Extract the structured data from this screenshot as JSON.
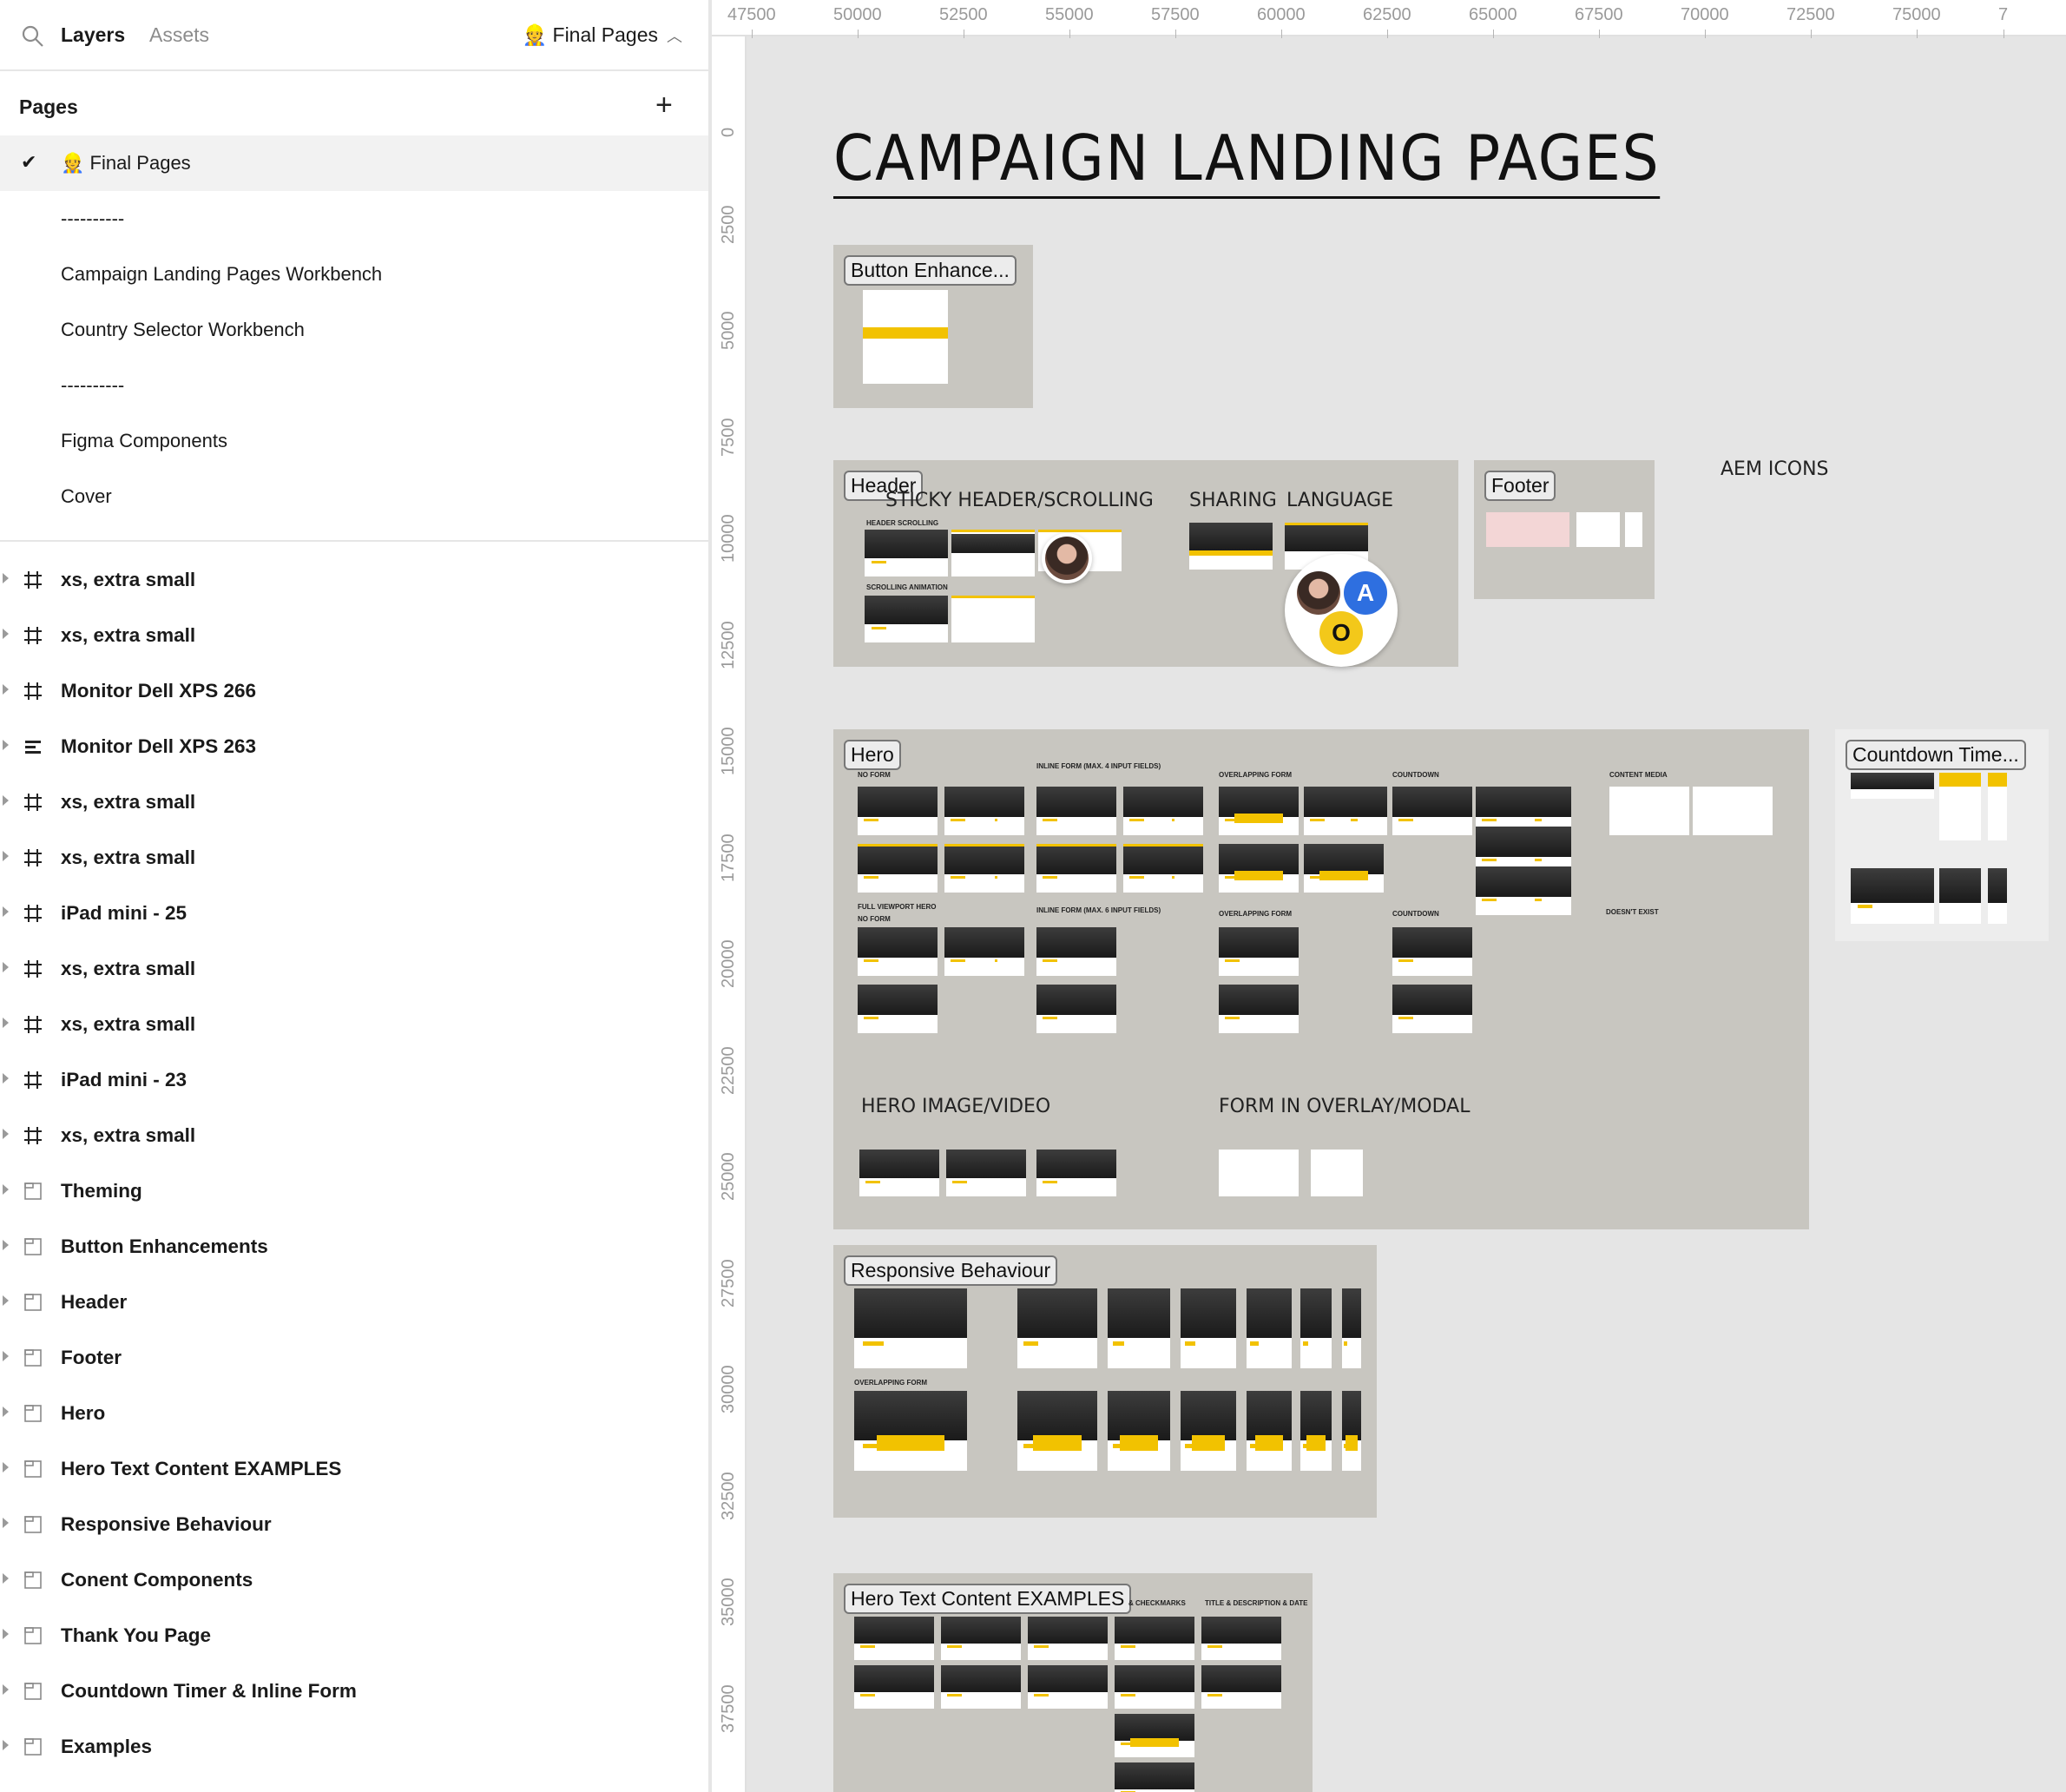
{
  "sidebar": {
    "tabs": {
      "layers": "Layers",
      "assets": "Assets"
    },
    "current_page": "👷 Final Pages",
    "pages_title": "Pages",
    "pages": [
      {
        "label": "👷 Final Pages",
        "active": true
      },
      {
        "label": "----------",
        "active": false
      },
      {
        "label": "Campaign Landing Pages Workbench",
        "active": false
      },
      {
        "label": "Country Selector Workbench",
        "active": false
      },
      {
        "label": "----------",
        "active": false
      },
      {
        "label": "Figma Components",
        "active": false
      },
      {
        "label": "Cover",
        "active": false
      }
    ],
    "layers": [
      {
        "name": "xs, extra small",
        "icon": "frame-icon"
      },
      {
        "name": "xs, extra small",
        "icon": "frame-icon"
      },
      {
        "name": "Monitor Dell XPS 266",
        "icon": "frame-icon"
      },
      {
        "name": "Monitor Dell XPS 263",
        "icon": "auto-layout-icon"
      },
      {
        "name": "xs, extra small",
        "icon": "frame-icon"
      },
      {
        "name": "xs, extra small",
        "icon": "frame-icon"
      },
      {
        "name": "iPad mini - 25",
        "icon": "frame-icon"
      },
      {
        "name": "xs, extra small",
        "icon": "frame-icon"
      },
      {
        "name": "xs, extra small",
        "icon": "frame-icon"
      },
      {
        "name": "iPad mini - 23",
        "icon": "frame-icon"
      },
      {
        "name": "xs, extra small",
        "icon": "frame-icon"
      },
      {
        "name": "Theming",
        "icon": "section-icon"
      },
      {
        "name": "Button Enhancements",
        "icon": "section-icon"
      },
      {
        "name": "Header",
        "icon": "section-icon"
      },
      {
        "name": "Footer",
        "icon": "section-icon"
      },
      {
        "name": "Hero",
        "icon": "section-icon"
      },
      {
        "name": "Hero Text Content EXAMPLES",
        "icon": "section-icon"
      },
      {
        "name": "Responsive Behaviour",
        "icon": "section-icon"
      },
      {
        "name": "Conent Components",
        "icon": "section-icon"
      },
      {
        "name": "Thank You Page",
        "icon": "section-icon"
      },
      {
        "name": "Countdown Timer & Inline Form",
        "icon": "section-icon"
      },
      {
        "name": "Examples",
        "icon": "section-icon"
      }
    ]
  },
  "canvas": {
    "ruler_h": [
      "47500",
      "50000",
      "52500",
      "55000",
      "57500",
      "60000",
      "62500",
      "65000",
      "67500",
      "70000",
      "72500",
      "75000",
      "7"
    ],
    "ruler_v": [
      "0",
      "2500",
      "5000",
      "7500",
      "10000",
      "12500",
      "15000",
      "17500",
      "20000",
      "22500",
      "25000",
      "27500",
      "30000",
      "32500",
      "35000",
      "37500"
    ],
    "title": "CAMPAIGN LANDING PAGES",
    "sections": {
      "button_enh": "Button Enhance...",
      "header": "Header",
      "footer": "Footer",
      "hero": "Hero",
      "countdown": "Countdown Time...",
      "responsive": "Responsive Behaviour",
      "hero_text": "Hero Text Content EXAMPLES"
    },
    "headings": {
      "sticky": "STICKY HEADER/SCROLLING",
      "sharing": "SHARING",
      "language": "LANGUAGE",
      "aem": "AEM ICONS",
      "hero_image": "HERO IMAGE/VIDEO",
      "form_overlay": "FORM IN OVERLAY/MODAL",
      "no_form": "NO FORM",
      "inline_form4": "INLINE FORM (MAX. 4 INPUT FIELDS)",
      "overlapping": "OVERLAPPING FORM",
      "countdown_lbl": "COUNTDOWN",
      "content_media": "CONTENT MEDIA",
      "full_viewport": "FULL VIEWPORT HERO",
      "no_form2": "NO FORM",
      "inline_form6": "INLINE FORM (MAX. 6 INPUT FIELDS)",
      "overlapping2": "OVERLAPPING FORM",
      "countdown2": "COUNTDOWN",
      "doesnt_exist": "DOESN'T EXIST",
      "header_scrolling": "HEADER SCROLLING",
      "scrolling_animation": "SCROLLING ANIMATION",
      "overlapping3": "OVERLAPPING FORM",
      "checkmarks": "& CHECKMARKS",
      "title_desc": "TITLE & DESCRIPTION & DATE"
    },
    "badges": {
      "a": "A",
      "o": "O"
    }
  }
}
